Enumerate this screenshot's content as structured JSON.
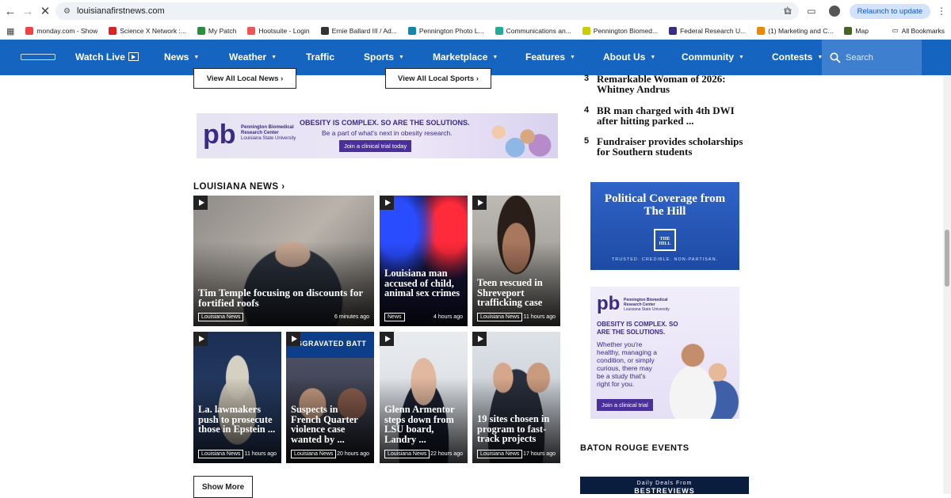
{
  "browser": {
    "url": "louisianafirstnews.com",
    "relaunch_label": "Relaunch to update",
    "all_bookmarks": "All Bookmarks",
    "bookmarks": [
      {
        "label": "monday.com - Show",
        "color": "#e44"
      },
      {
        "label": "Science X Network :...",
        "color": "#d22"
      },
      {
        "label": "My Patch",
        "color": "#2a8f3c"
      },
      {
        "label": "Hootsuite - Login",
        "color": "#e55"
      },
      {
        "label": "Ernie Ballard III / Ad...",
        "color": "#333"
      },
      {
        "label": "Pennington Photo L...",
        "color": "#18a"
      },
      {
        "label": "Communications an...",
        "color": "#2a9"
      },
      {
        "label": "Pennington Biomed...",
        "color": "#cc0"
      },
      {
        "label": "Federal Research U...",
        "color": "#3b2a86"
      },
      {
        "label": "(1) Marketing and C...",
        "color": "#e80"
      },
      {
        "label": "Map",
        "color": "#462"
      }
    ]
  },
  "nav": {
    "items": [
      "Watch Live",
      "News",
      "Weather",
      "Traffic",
      "Sports",
      "Marketplace",
      "Features",
      "About Us",
      "Community",
      "Contests"
    ],
    "search_placeholder": "Search"
  },
  "buttons": {
    "view_local_news": "View All Local News  ›",
    "view_local_sports": "View All Local Sports  ›",
    "show_more": "Show More"
  },
  "banner_ad": {
    "org1": "Pennington Biomedical",
    "org2": "Research Center",
    "org3": "Louisiana State University",
    "headline": "OBESITY IS COMPLEX. SO ARE THE SOLUTIONS.",
    "sub": "Be a part of what's next in obesity research.",
    "cta": "Join a clinical trial today"
  },
  "section": {
    "title": "LOUISIANA NEWS ›"
  },
  "cards": [
    {
      "headline": "Tim Temple focusing on discounts for fortified roofs",
      "tag": "Louisiana News",
      "time": "6 minutes ago"
    },
    {
      "headline": "Louisiana man accused of child, animal sex crimes",
      "tag": "News",
      "time": "4 hours ago"
    },
    {
      "headline": "Teen rescued in Shreveport trafficking case",
      "tag": "Louisiana News",
      "time": "11 hours ago"
    },
    {
      "headline": "La. lawmakers push to prosecute those in Epstein ...",
      "tag": "Louisiana News",
      "time": "11 hours ago"
    },
    {
      "headline": "Suspects in French Quarter violence case wanted by ...",
      "tag": "Louisiana News",
      "time": "20 hours ago"
    },
    {
      "headline": "Glenn Armentor steps down from LSU board, Landry ...",
      "tag": "Louisiana News",
      "time": "22 hours ago"
    },
    {
      "headline": "19 sites chosen in program to fast-track projects",
      "tag": "Louisiana News",
      "time": "17 hours ago"
    }
  ],
  "card5_overlay": "AGGRAVATED BATT",
  "trending": [
    {
      "num": "3",
      "text": "Remarkable Woman of 2026: Whitney Andrus"
    },
    {
      "num": "4",
      "text": "BR man charged with 4th DWI after hitting parked ..."
    },
    {
      "num": "5",
      "text": "Fundraiser provides scholarships for Southern students"
    }
  ],
  "hill_ad": {
    "headline": "Political Coverage from The Hill",
    "logo": "THE HILL",
    "tagline": "TRUSTED. CREDIBLE. NON-PARTISAN."
  },
  "pb_ad": {
    "org1": "Pennington Biomedical",
    "org2": "Research Center",
    "org3": "Louisiana State University",
    "headline": "OBESITY IS COMPLEX. SO ARE THE SOLUTIONS.",
    "body": "Whether you're healthy, managing a condition, or simply curious, there may be a study that's right for you.",
    "cta": "Join a clinical trial"
  },
  "events": {
    "title": "BATON ROUGE EVENTS"
  },
  "deals_ad": {
    "line1": "Daily Deals From",
    "line2": "BESTREVIEWS"
  }
}
